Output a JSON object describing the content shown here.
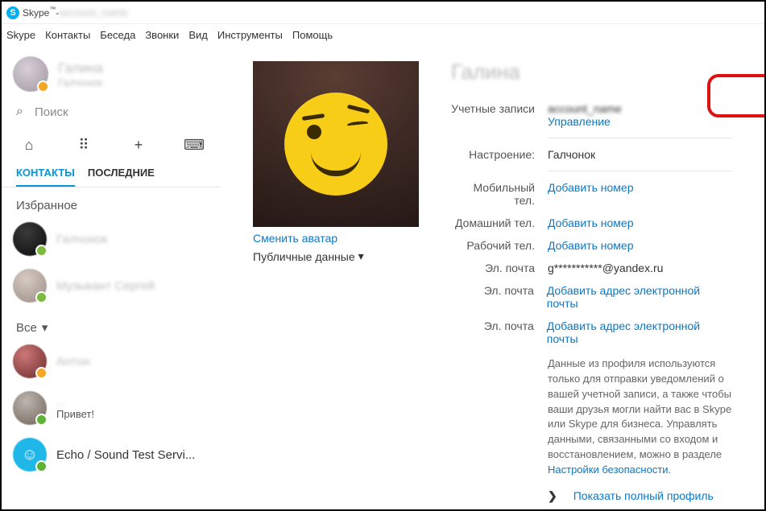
{
  "window": {
    "app": "Skype",
    "tm": "™",
    "titleSep": " - ",
    "userHint": "account_name"
  },
  "menu": [
    "Skype",
    "Контакты",
    "Беседа",
    "Звонки",
    "Вид",
    "Инструменты",
    "Помощь"
  ],
  "me": {
    "name": "Галина",
    "sub": "Галчонок"
  },
  "search": {
    "placeholder": "Поиск"
  },
  "tabs": {
    "contacts": "КОНТАКТЫ",
    "recent": "ПОСЛЕДНИЕ"
  },
  "sections": {
    "fav": "Избранное",
    "all": "Все"
  },
  "contacts": {
    "fav": [
      {
        "name": "Галчонок"
      },
      {
        "name": "Музыкант Сергей"
      }
    ],
    "all": [
      {
        "name": "Антон"
      },
      {
        "name": "...",
        "sub": "Привет!"
      },
      {
        "name": "Echo / Sound Test Servi..."
      }
    ]
  },
  "profile": {
    "displayName": "Галина",
    "changeAvatar": "Сменить аватар",
    "publicData": "Публичные данные",
    "rows": {
      "accountsLabel": "Учетные записи",
      "accountsVal": "account_name",
      "manage": "Управление",
      "moodLabel": "Настроение:",
      "moodVal": "Галчонок",
      "mobileLabel": "Мобильный тел.",
      "homeLabel": "Домашний тел.",
      "workLabel": "Рабочий тел.",
      "addNumber": "Добавить номер",
      "emailLabel": "Эл. почта",
      "emailVal": "g***********@yandex.ru",
      "addEmail": "Добавить адрес электронной почты"
    },
    "help": {
      "text1": "Данные из профиля используются только для отправки уведомлений о вашей учетной записи, а также чтобы ваши друзья могли найти вас в Skype или Skype для бизнеса. Управлять данными, связанными со входом и восстановлением, можно в разделе ",
      "link": "Настройки безопасности",
      "tail": "."
    },
    "fullProfile": "Показать полный профиль"
  },
  "icons": {
    "home": "⌂",
    "dial": "⠿",
    "add": "+",
    "bot": "⌨",
    "search": "🔍",
    "dropdown": "▾",
    "chev": "❯"
  }
}
